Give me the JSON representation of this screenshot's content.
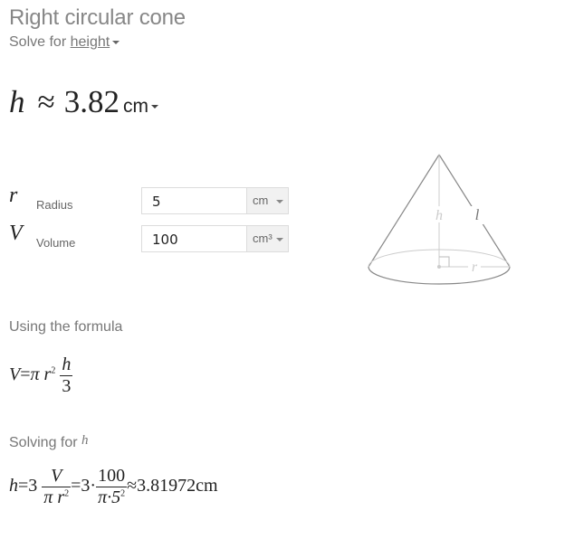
{
  "header": {
    "title": "Right circular cone",
    "solve_for_prefix": "Solve for",
    "solve_for_target": "height"
  },
  "result": {
    "variable": "h",
    "approx_symbol": "≈",
    "value": "3.82",
    "unit": "cm"
  },
  "inputs": [
    {
      "symbol": "r",
      "label": "Radius",
      "value": "5",
      "unit": "cm"
    },
    {
      "symbol": "V",
      "label": "Volume",
      "value": "100",
      "unit": "cm³"
    }
  ],
  "diagram": {
    "labels": {
      "height": "h",
      "slant": "l",
      "radius": "r"
    },
    "colors": {
      "outline": "#888888",
      "guides": "#cccccc"
    }
  },
  "formula": {
    "heading": "Using the formula",
    "lhs": "V",
    "eq": "=",
    "pi": "π",
    "r": "r",
    "exp": "2",
    "num": "h",
    "den": "3"
  },
  "solving": {
    "heading_prefix": "Solving for",
    "heading_var": "h",
    "lhs": "h",
    "eq": "=",
    "coef": "3",
    "frac1_num": "V",
    "frac1_den_pi": "π",
    "frac1_den_r": "r",
    "frac1_den_exp": "2",
    "coef2": "3·",
    "frac2_num": "100",
    "frac2_den": "π·5",
    "frac2_den_exp": "2",
    "approx": "≈",
    "result": "3.81972cm"
  }
}
